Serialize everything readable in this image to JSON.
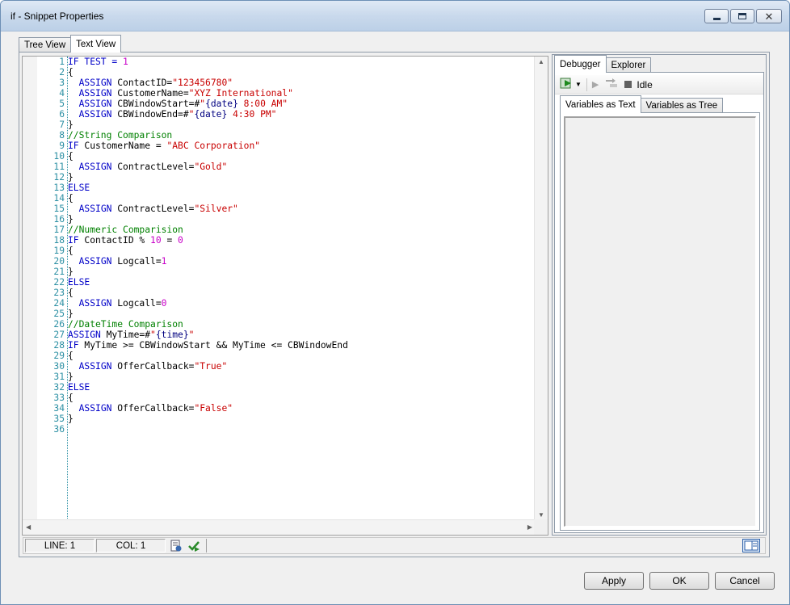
{
  "window": {
    "title": "if - Snippet Properties"
  },
  "main_tabs": [
    "Tree View",
    "Text View"
  ],
  "editor": {
    "lines": [
      [
        [
          "k",
          "IF TEST = "
        ],
        [
          "n",
          "1"
        ]
      ],
      [
        [
          "p",
          "{"
        ]
      ],
      [
        [
          "p",
          "  "
        ],
        [
          "k",
          "ASSIGN"
        ],
        [
          "p",
          " ContactID="
        ],
        [
          "s",
          "\"123456780\""
        ]
      ],
      [
        [
          "p",
          "  "
        ],
        [
          "k",
          "ASSIGN"
        ],
        [
          "p",
          " CustomerName="
        ],
        [
          "s",
          "\"XYZ International\""
        ]
      ],
      [
        [
          "p",
          "  "
        ],
        [
          "k",
          "ASSIGN"
        ],
        [
          "p",
          " CBWindowStart=#"
        ],
        [
          "s",
          "\""
        ],
        [
          "v",
          "{date}"
        ],
        [
          "s",
          " 8:00 AM\""
        ]
      ],
      [
        [
          "p",
          "  "
        ],
        [
          "k",
          "ASSIGN"
        ],
        [
          "p",
          " CBWindowEnd=#"
        ],
        [
          "s",
          "\""
        ],
        [
          "v",
          "{date}"
        ],
        [
          "s",
          " 4:30 PM\""
        ]
      ],
      [
        [
          "p",
          "}"
        ]
      ],
      [
        [
          "c",
          "//String Comparison"
        ]
      ],
      [
        [
          "k",
          "IF"
        ],
        [
          "p",
          " CustomerName = "
        ],
        [
          "s",
          "\"ABC Corporation\""
        ]
      ],
      [
        [
          "p",
          "{"
        ]
      ],
      [
        [
          "p",
          "  "
        ],
        [
          "k",
          "ASSIGN"
        ],
        [
          "p",
          " ContractLevel="
        ],
        [
          "s",
          "\"Gold\""
        ]
      ],
      [
        [
          "p",
          "}"
        ]
      ],
      [
        [
          "k",
          "ELSE"
        ]
      ],
      [
        [
          "p",
          "{"
        ]
      ],
      [
        [
          "p",
          "  "
        ],
        [
          "k",
          "ASSIGN"
        ],
        [
          "p",
          " ContractLevel="
        ],
        [
          "s",
          "\"Silver\""
        ]
      ],
      [
        [
          "p",
          "}"
        ]
      ],
      [
        [
          "c",
          "//Numeric Comparision"
        ]
      ],
      [
        [
          "k",
          "IF"
        ],
        [
          "p",
          " ContactID % "
        ],
        [
          "n",
          "10"
        ],
        [
          "p",
          " = "
        ],
        [
          "n",
          "0"
        ]
      ],
      [
        [
          "p",
          "{"
        ]
      ],
      [
        [
          "p",
          "  "
        ],
        [
          "k",
          "ASSIGN"
        ],
        [
          "p",
          " Logcall="
        ],
        [
          "n",
          "1"
        ]
      ],
      [
        [
          "p",
          "}"
        ]
      ],
      [
        [
          "k",
          "ELSE"
        ]
      ],
      [
        [
          "p",
          "{"
        ]
      ],
      [
        [
          "p",
          "  "
        ],
        [
          "k",
          "ASSIGN"
        ],
        [
          "p",
          " Logcall="
        ],
        [
          "n",
          "0"
        ]
      ],
      [
        [
          "p",
          "}"
        ]
      ],
      [
        [
          "c",
          "//DateTime Comparison"
        ]
      ],
      [
        [
          "k",
          "ASSIGN"
        ],
        [
          "p",
          " MyTime=#"
        ],
        [
          "s",
          "\""
        ],
        [
          "v",
          "{time}"
        ],
        [
          "s",
          "\""
        ]
      ],
      [
        [
          "k",
          "IF"
        ],
        [
          "p",
          " MyTime >= CBWindowStart && MyTime <= CBWindowEnd"
        ]
      ],
      [
        [
          "p",
          "{"
        ]
      ],
      [
        [
          "p",
          "  "
        ],
        [
          "k",
          "ASSIGN"
        ],
        [
          "p",
          " OfferCallback="
        ],
        [
          "s",
          "\"True\""
        ]
      ],
      [
        [
          "p",
          "}"
        ]
      ],
      [
        [
          "k",
          "ELSE"
        ]
      ],
      [
        [
          "p",
          "{"
        ]
      ],
      [
        [
          "p",
          "  "
        ],
        [
          "k",
          "ASSIGN"
        ],
        [
          "p",
          " OfferCallback="
        ],
        [
          "s",
          "\"False\""
        ]
      ],
      [
        [
          "p",
          "}"
        ]
      ],
      [
        [
          "p",
          ""
        ]
      ]
    ]
  },
  "side_tabs": [
    "Debugger",
    "Explorer"
  ],
  "debugger": {
    "status": "Idle"
  },
  "var_tabs": [
    "Variables as Text",
    "Variables as Tree"
  ],
  "status": {
    "line": "LINE: 1",
    "col": "COL: 1"
  },
  "buttons": {
    "apply": "Apply",
    "ok": "OK",
    "cancel": "Cancel"
  },
  "colors": {
    "keyword": "#0000c8",
    "string": "#c80000",
    "number": "#c800c8",
    "comment": "#008000",
    "variable": "#000080",
    "plain": "#000000",
    "line_number": "#2b8fa3"
  },
  "icons": [
    "minimize-icon",
    "maximize-icon",
    "close-icon",
    "run-icon",
    "dropdown-arrow-icon",
    "play-icon",
    "step-icon",
    "stop-icon",
    "check-syntax-icon",
    "validate-icon",
    "layout-icon"
  ]
}
